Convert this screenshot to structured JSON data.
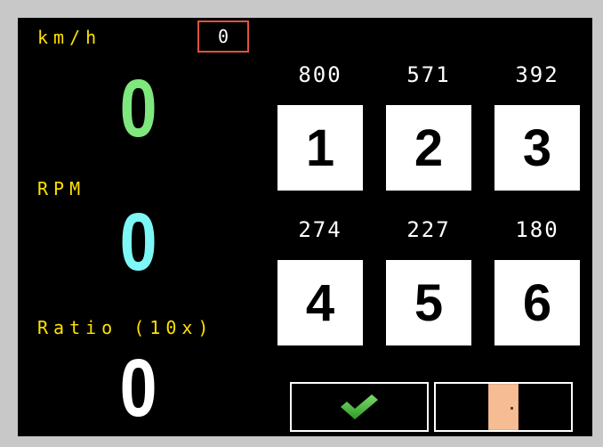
{
  "speed": {
    "unit_label": "km/h",
    "value": "0",
    "color": "#7ee87e"
  },
  "counter": {
    "value": "0"
  },
  "rpm": {
    "label": "RPM",
    "value": "0",
    "color": "#7ef7f7"
  },
  "ratio": {
    "label": "Ratio (10x)",
    "value": "0",
    "color": "#ffffff"
  },
  "gears": [
    {
      "number": "1",
      "ratio_value": "800"
    },
    {
      "number": "2",
      "ratio_value": "571"
    },
    {
      "number": "3",
      "ratio_value": "392"
    },
    {
      "number": "4",
      "ratio_value": "274"
    },
    {
      "number": "5",
      "ratio_value": "227"
    },
    {
      "number": "6",
      "ratio_value": "180"
    }
  ],
  "actions": {
    "confirm_icon": "checkmark-icon",
    "confirm_color": "#45b83a",
    "exit_icon": "door-icon",
    "exit_color": "#f6bd95"
  },
  "label_color": "#ffe000",
  "counter_border_color": "#e0533a"
}
